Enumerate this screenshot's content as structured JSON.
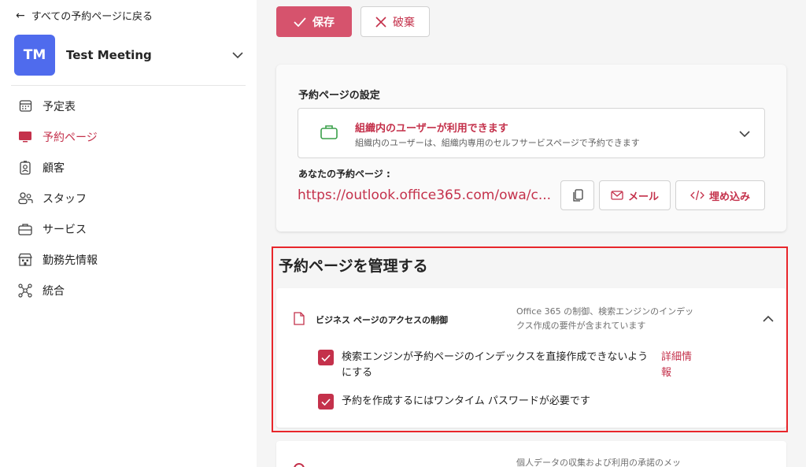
{
  "sidebar": {
    "back_label": "すべての予約ページに戻る",
    "avatar_initials": "TM",
    "meeting_name": "Test Meeting",
    "nav": [
      {
        "label": "予定表",
        "icon": "calendar-icon"
      },
      {
        "label": "予約ページ",
        "icon": "monitor-icon",
        "active": true
      },
      {
        "label": "顧客",
        "icon": "contact-card-icon"
      },
      {
        "label": "スタッフ",
        "icon": "people-icon"
      },
      {
        "label": "サービス",
        "icon": "briefcase-icon"
      },
      {
        "label": "勤務先情報",
        "icon": "building-icon"
      },
      {
        "label": "統合",
        "icon": "network-icon"
      }
    ]
  },
  "toolbar": {
    "save_label": "保存",
    "discard_label": "破棄"
  },
  "settings": {
    "title": "予約ページの設定",
    "access_main": "組織内のユーザーが利用できます",
    "access_sub": "組織内のユーザーは、組織内専用のセルフサービスページで予約できます",
    "your_page_label": "あなたの予約ページ :",
    "url": "https://outlook.office365.com/owa/c...",
    "mail_label": "メール",
    "embed_label": "埋め込み"
  },
  "manage": {
    "title": "予約ページを管理する",
    "access_control_title": "ビジネス ページのアクセスの制御",
    "access_desc": "Office 365 の制御、検索エンジンのインデックス作成の要件が含まれています",
    "checkbox1_label": "検索エンジンが予約ページのインデックスを直接作成できないようにする",
    "more_link": "詳細情報",
    "checkbox2_label": "予約を作成するにはワンタイム パスワードが必要です",
    "next_desc": "個人データの収集および利用の承諾のメッ"
  },
  "colors": {
    "accent": "#c4314b",
    "save_bg": "#d6536d",
    "avatar_bg": "#4f6bed",
    "highlight_outline": "#e8262b"
  }
}
